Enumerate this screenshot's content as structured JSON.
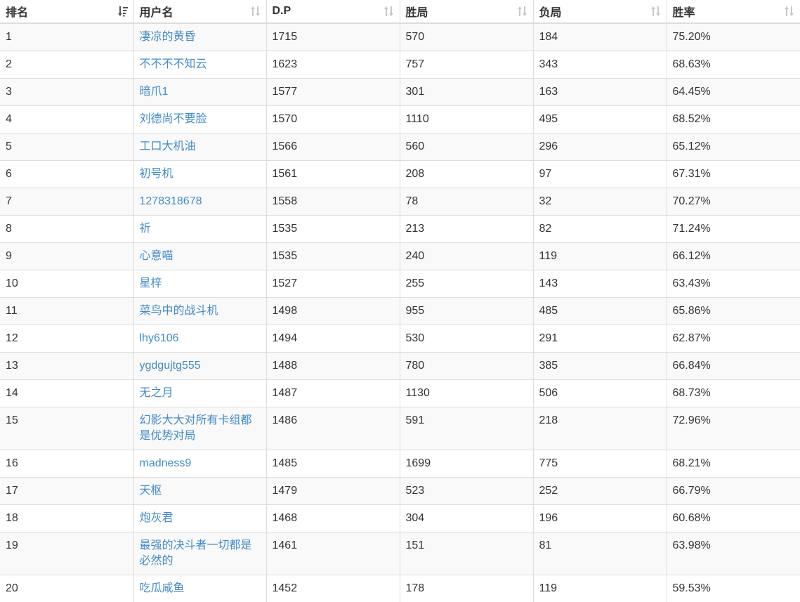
{
  "columns": [
    {
      "label": "排名",
      "sort": "active-desc"
    },
    {
      "label": "用户名",
      "sort": "both"
    },
    {
      "label": "D.P",
      "sort": "both"
    },
    {
      "label": "胜局",
      "sort": "both"
    },
    {
      "label": "负局",
      "sort": "both"
    },
    {
      "label": "胜率",
      "sort": "both"
    }
  ],
  "rows": [
    {
      "rank": "1",
      "user": "凄凉的黄昏",
      "dp": "1715",
      "wins": "570",
      "losses": "184",
      "rate": "75.20%"
    },
    {
      "rank": "2",
      "user": "不不不不知云",
      "dp": "1623",
      "wins": "757",
      "losses": "343",
      "rate": "68.63%"
    },
    {
      "rank": "3",
      "user": "暗爪1",
      "dp": "1577",
      "wins": "301",
      "losses": "163",
      "rate": "64.45%"
    },
    {
      "rank": "4",
      "user": "刘德尚不要脸",
      "dp": "1570",
      "wins": "1110",
      "losses": "495",
      "rate": "68.52%"
    },
    {
      "rank": "5",
      "user": "工口大机油",
      "dp": "1566",
      "wins": "560",
      "losses": "296",
      "rate": "65.12%"
    },
    {
      "rank": "6",
      "user": "初号机",
      "dp": "1561",
      "wins": "208",
      "losses": "97",
      "rate": "67.31%"
    },
    {
      "rank": "7",
      "user": "1278318678",
      "dp": "1558",
      "wins": "78",
      "losses": "32",
      "rate": "70.27%"
    },
    {
      "rank": "8",
      "user": "祈",
      "dp": "1535",
      "wins": "213",
      "losses": "82",
      "rate": "71.24%"
    },
    {
      "rank": "9",
      "user": "心意喵",
      "dp": "1535",
      "wins": "240",
      "losses": "119",
      "rate": "66.12%"
    },
    {
      "rank": "10",
      "user": "星梓",
      "dp": "1527",
      "wins": "255",
      "losses": "143",
      "rate": "63.43%"
    },
    {
      "rank": "11",
      "user": "菜鸟中的战斗机",
      "dp": "1498",
      "wins": "955",
      "losses": "485",
      "rate": "65.86%"
    },
    {
      "rank": "12",
      "user": "lhy6106",
      "dp": "1494",
      "wins": "530",
      "losses": "291",
      "rate": "62.87%"
    },
    {
      "rank": "13",
      "user": "ygdgujtg555",
      "dp": "1488",
      "wins": "780",
      "losses": "385",
      "rate": "66.84%"
    },
    {
      "rank": "14",
      "user": "无之月",
      "dp": "1487",
      "wins": "1130",
      "losses": "506",
      "rate": "68.73%"
    },
    {
      "rank": "15",
      "user": "幻影大大对所有卡组都是优势对局",
      "dp": "1486",
      "wins": "591",
      "losses": "218",
      "rate": "72.96%"
    },
    {
      "rank": "16",
      "user": "madness9",
      "dp": "1485",
      "wins": "1699",
      "losses": "775",
      "rate": "68.21%"
    },
    {
      "rank": "17",
      "user": "天枢",
      "dp": "1479",
      "wins": "523",
      "losses": "252",
      "rate": "66.79%"
    },
    {
      "rank": "18",
      "user": "炮灰君",
      "dp": "1468",
      "wins": "304",
      "losses": "196",
      "rate": "60.68%"
    },
    {
      "rank": "19",
      "user": "最强的决斗者一切都是必然的",
      "dp": "1461",
      "wins": "151",
      "losses": "81",
      "rate": "63.98%"
    },
    {
      "rank": "20",
      "user": "吃瓜咸鱼",
      "dp": "1452",
      "wins": "178",
      "losses": "119",
      "rate": "59.53%"
    }
  ],
  "colors": {
    "link": "#428bca",
    "text": "#333333",
    "border": "#dddddd",
    "stripe": "#f9f9f9",
    "sort_icon_active": "#555555",
    "sort_icon_inactive": "#c8c8c8"
  },
  "icons": {
    "active": "sort-desc-icon",
    "inactive": "sort-both-icon"
  }
}
